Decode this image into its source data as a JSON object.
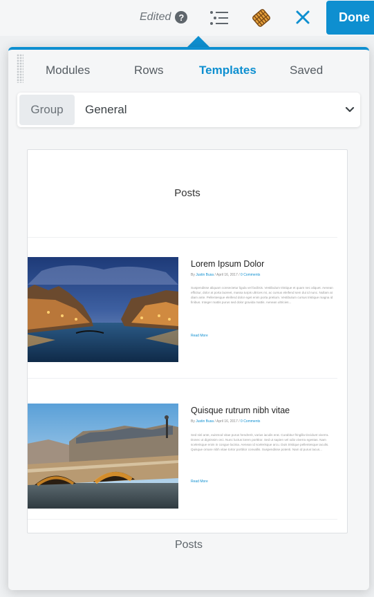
{
  "toolbar": {
    "edited_label": "Edited",
    "help_icon": "?",
    "done_label": "Done",
    "accent_color": "#0e8fd0"
  },
  "panel": {
    "tabs": [
      {
        "label": "Modules",
        "active": false
      },
      {
        "label": "Rows",
        "active": false
      },
      {
        "label": "Templates",
        "active": true
      },
      {
        "label": "Saved",
        "active": false
      }
    ],
    "group": {
      "label": "Group",
      "value": "General"
    },
    "template": {
      "caption": "Posts",
      "preview": {
        "heading": "Posts",
        "posts": [
          {
            "title": "Lorem Ipsum Dolor",
            "meta_prefix": "By",
            "author": "Justin Busa",
            "date": "April 16, 2017",
            "comments": "0 Comments",
            "excerpt": "Suspendisse aliquam consectetur ligula vel facilisis. Vestibulum tristique et quam nec aliquet. Aenean efficitur, dolor at porta laoreet, massa turpis ultrices mi, ac cursus eleifend sem dui id nunc. Nullam at diam ante. Pellentesque eleifend dolor eget enim porta pretium. Vestibulum cursus tristique magna id finibus. Integer mattis purus sed dolor gravida mattis. Aenean ultricies...",
            "read_more": "Read More"
          },
          {
            "title": "Quisque rutrum nibh vitae",
            "meta_prefix": "By",
            "author": "Justin Busa",
            "date": "April 16, 2017",
            "comments": "0 Comments",
            "excerpt": "Sed nisl ante, euismod vitae purus hendrerit, varius iaculis erat. Curabitur fringilla tincidunt viverra. Donec ut dignissim orci. Nunc luctus lorem porttitor. Sed ut sapien vel odio viverra egestas. Nam scelerisque enim in congue lacinia. Aenean id scelerisque arcu. Duis tristique pellentesque iaculis. Quisque ornare nibh vitae tortor porttitor convallis. Suspendisse potenti. Nam id purus lacus...",
            "read_more": "Read More"
          }
        ]
      }
    }
  }
}
